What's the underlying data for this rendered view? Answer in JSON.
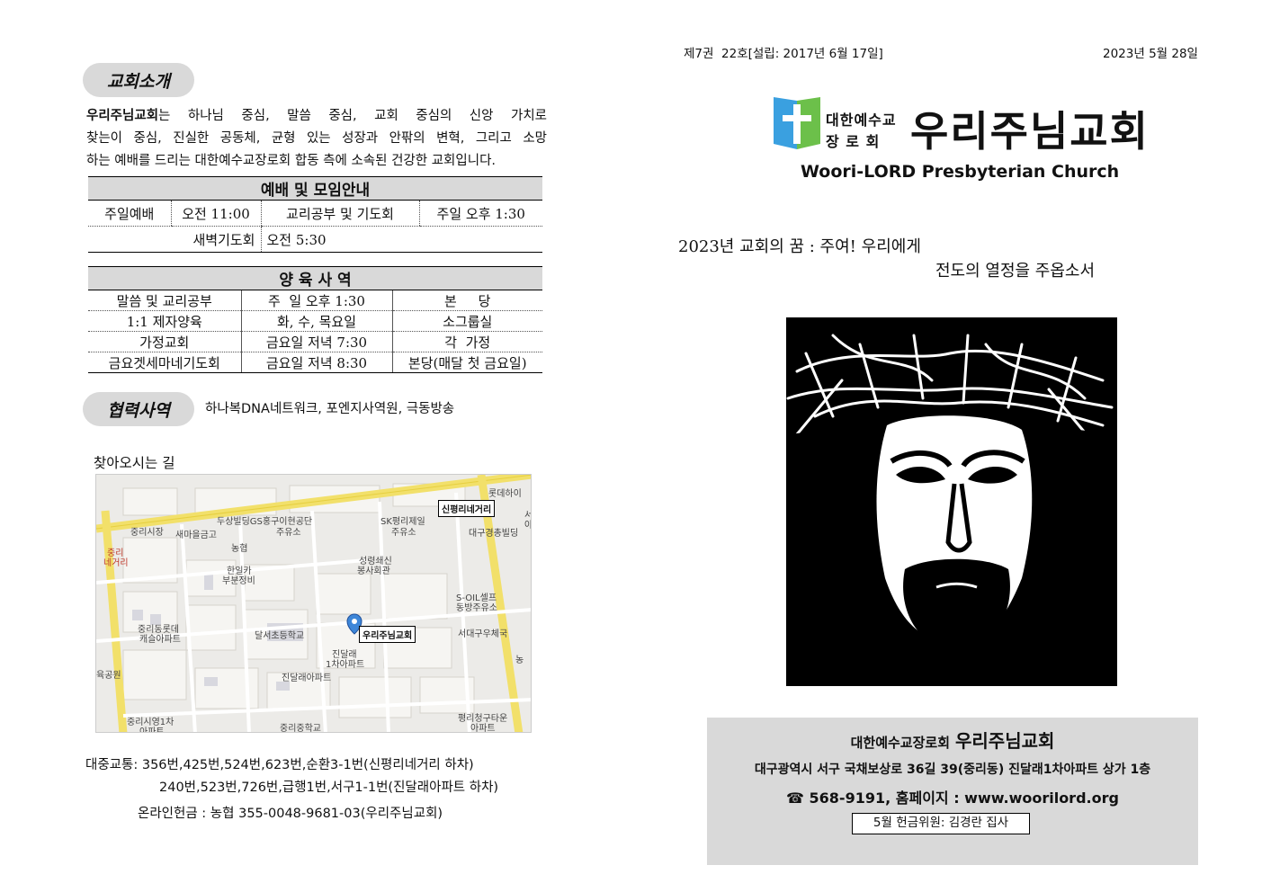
{
  "intro": {
    "pill": "교회소개",
    "church_bold": "우리주님교회",
    "line1_rest": "는 하나님 중심, 말씀 중심, 교회 중심의 신앙 가치로",
    "line2": "찾는이 중심, 진실한 공동체, 균형 있는 성장과 안팎의 변혁, 그리고 소망",
    "line3": "하는 예배를 드리는 대한예수교장로회 합동 측에 소속된 건강한 교회입니다."
  },
  "worship": {
    "title": "예배 및 모임안내",
    "row1": [
      "주일예배",
      "오전 11:00",
      "교리공부 및 기도회",
      "주일 오후 1:30"
    ],
    "row2": [
      "새벽기도회",
      "오전 5:30"
    ]
  },
  "nurture": {
    "title": "양 육 사 역",
    "rows": [
      [
        "말씀 및 교리공부",
        "주  일 오후 1:30",
        "본     당"
      ],
      [
        "1:1 제자양육",
        "화, 수, 목요일",
        "소그룹실"
      ],
      [
        "가정교회",
        "금요일 저녁 7:30",
        "각  가정"
      ],
      [
        "금요겟세마네기도회",
        "금요일 저녁 8:30",
        "본당(매달 첫 금요일)"
      ]
    ]
  },
  "coop": {
    "pill": "협력사역",
    "text": "하나복DNA네트워크, 포엔지사역원, 극동방송"
  },
  "directions": {
    "title": "찾아오시는 길",
    "map_labels": [
      "롯데하이",
      "중리시장",
      "새마을금고",
      "두상빌딩GS홍구이현공단",
      "주유소",
      "SK평리제일",
      "주유소",
      "대구경총빌딩",
      "농협",
      "중리",
      "네거리",
      "성령쇄신",
      "봉사회관",
      "한일카",
      "부분정비",
      "S-OIL셀프",
      "동방주유소",
      "중리동롯데",
      "캐슬아파트",
      "달서초등학교",
      "서대구우체국",
      "진달래",
      "1차아파트",
      "진달래아파트",
      "육공원",
      "중리시영1차",
      "아파트",
      "중리중학교",
      "평리청구타운",
      "아파트",
      "서",
      "아",
      "농"
    ],
    "map_box_intersection": "신평리네거리",
    "map_box_church": "우리주님교회"
  },
  "transit": {
    "line1": "대중교통: 356번,425번,524번,623번,순환3-1번(신평리네거리 하차)",
    "line2": "240번,523번,726번,급행1번,서구1-1번(진달래아파트 하차)",
    "offering": "온라인헌금 : 농협 355-0048-9681-03(우리주님교회)"
  },
  "header": {
    "issue": "제7권  22호[설립: 2017년 6월 17일]",
    "date": "2023년 5월 28일"
  },
  "logo": {
    "sub1": "대한예수교",
    "sub2": "장 로 회",
    "name": "우리주님교회",
    "english": "Woori-LORD Presbyterian Church"
  },
  "vision": {
    "line1": "2023년 교회의 꿈 : 주여! 우리에게",
    "line2": "전도의 열정을 주옵소서"
  },
  "footer": {
    "denom": "대한예수교장로회",
    "name": "우리주님교회",
    "address": "대구광역시 서구 국채보상로 36길 39(중리동) 진달래1차아파트 상가 1층",
    "contact": "☎ 568-9191, 홈페이지 : www.woorilord.org",
    "offering_member": "5월 헌금위원: 김경란 집사"
  },
  "colors": {
    "logo_blue": "#3aa0e0",
    "logo_green": "#6cc04a",
    "gray": "#d9d9d9"
  }
}
